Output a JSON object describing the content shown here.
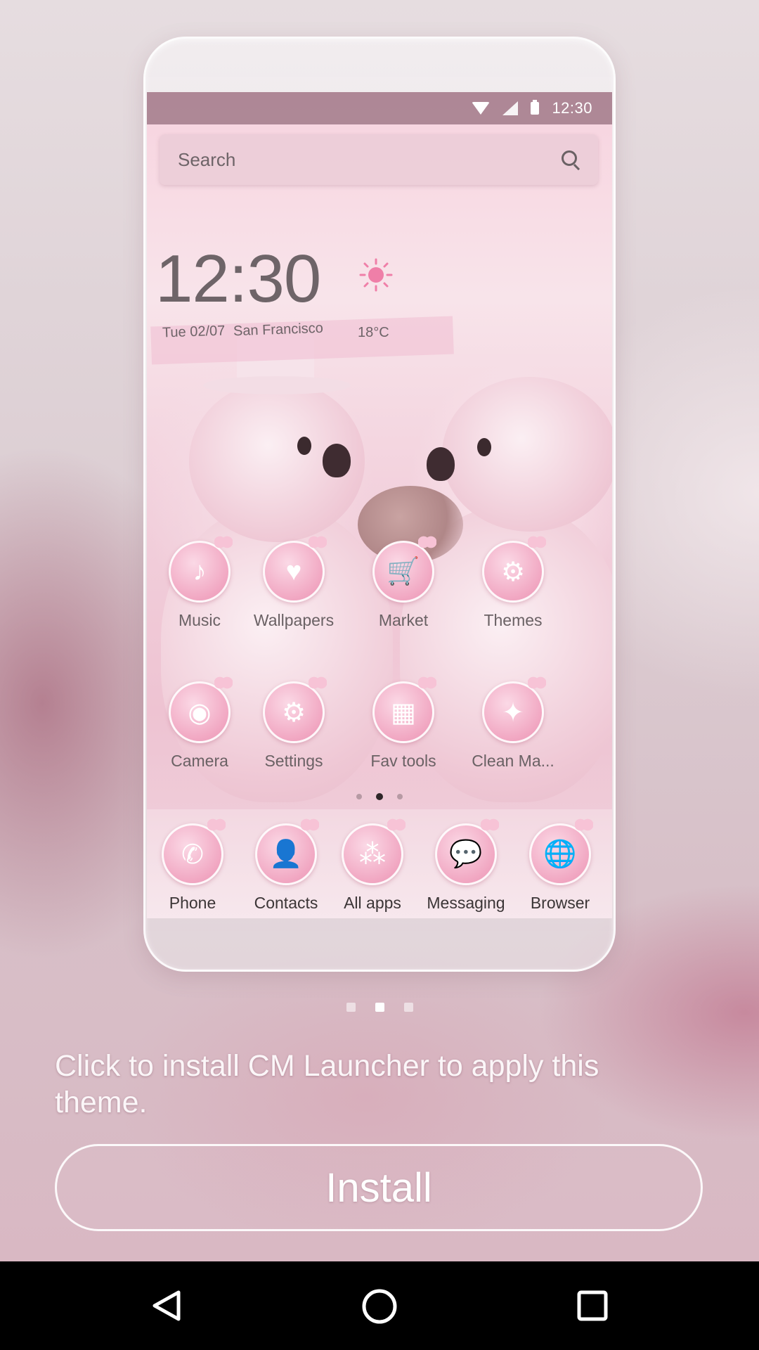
{
  "preview": {
    "status_bar": {
      "time": "12:30"
    },
    "search": {
      "placeholder": "Search"
    },
    "clock_widget": {
      "time": "12:30",
      "date": "Tue  02/07",
      "city": "San Francisco",
      "temperature": "18°C",
      "weather_icon": "sun-icon"
    },
    "apps_row1": [
      {
        "label": "Music",
        "icon": "music-icon"
      },
      {
        "label": "Wallpapers",
        "icon": "heart-icon"
      },
      {
        "label": "Market",
        "icon": "cart-icon"
      },
      {
        "label": "Themes",
        "icon": "gear-icon"
      }
    ],
    "apps_row2": [
      {
        "label": "Camera",
        "icon": "camera-icon"
      },
      {
        "label": "Settings",
        "icon": "gear-icon"
      },
      {
        "label": "Fav tools",
        "icon": "tools-icon"
      },
      {
        "label": "Clean Ma...",
        "icon": "broom-icon"
      }
    ],
    "dock": [
      {
        "label": "Phone",
        "icon": "phone-icon"
      },
      {
        "label": "Contacts",
        "icon": "person-icon"
      },
      {
        "label": "All apps",
        "icon": "grid-icon"
      },
      {
        "label": "Messaging",
        "icon": "chat-icon"
      },
      {
        "label": "Browser",
        "icon": "globe-icon"
      }
    ],
    "home_page_index": 2,
    "home_page_count": 3
  },
  "carousel": {
    "active_index": 2,
    "count": 3
  },
  "install_prompt": "Click to install CM Launcher to apply this theme.",
  "install_button": "Install",
  "colors": {
    "accent": "#ef9fbd",
    "text_light": "#ffffff",
    "nav_bar": "#000000"
  }
}
